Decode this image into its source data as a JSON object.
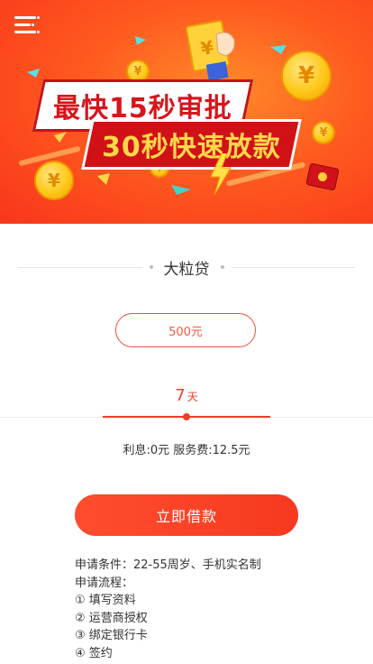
{
  "banner": {
    "headline_line1": "最快15秒审批",
    "headline_line2": "30秒快速放款",
    "coin_symbol": "¥",
    "colors": {
      "banner_red": "#f8361b",
      "banner_orange": "#ff8a2a",
      "coin_gold": "#ffc81a"
    },
    "icons": [
      "menu-icon",
      "lightning-icon",
      "red-envelope-icon",
      "hand-icon"
    ]
  },
  "product": {
    "title": "大粒贷"
  },
  "loan": {
    "amount": "500元",
    "days_value": "7",
    "days_unit": "天",
    "slider_fraction": 0.5,
    "fee_text": "利息:0元 服务费:12.5元"
  },
  "action": {
    "borrow_label": "立即借款"
  },
  "info": {
    "conditions": "申请条件：22-55周岁、手机实名制",
    "process_title": "申请流程：",
    "steps": [
      "① 填写资料",
      "② 运营商授权",
      "③ 绑定银行卡",
      "④ 签约"
    ]
  },
  "theme": {
    "accent": "#ef3d27"
  }
}
